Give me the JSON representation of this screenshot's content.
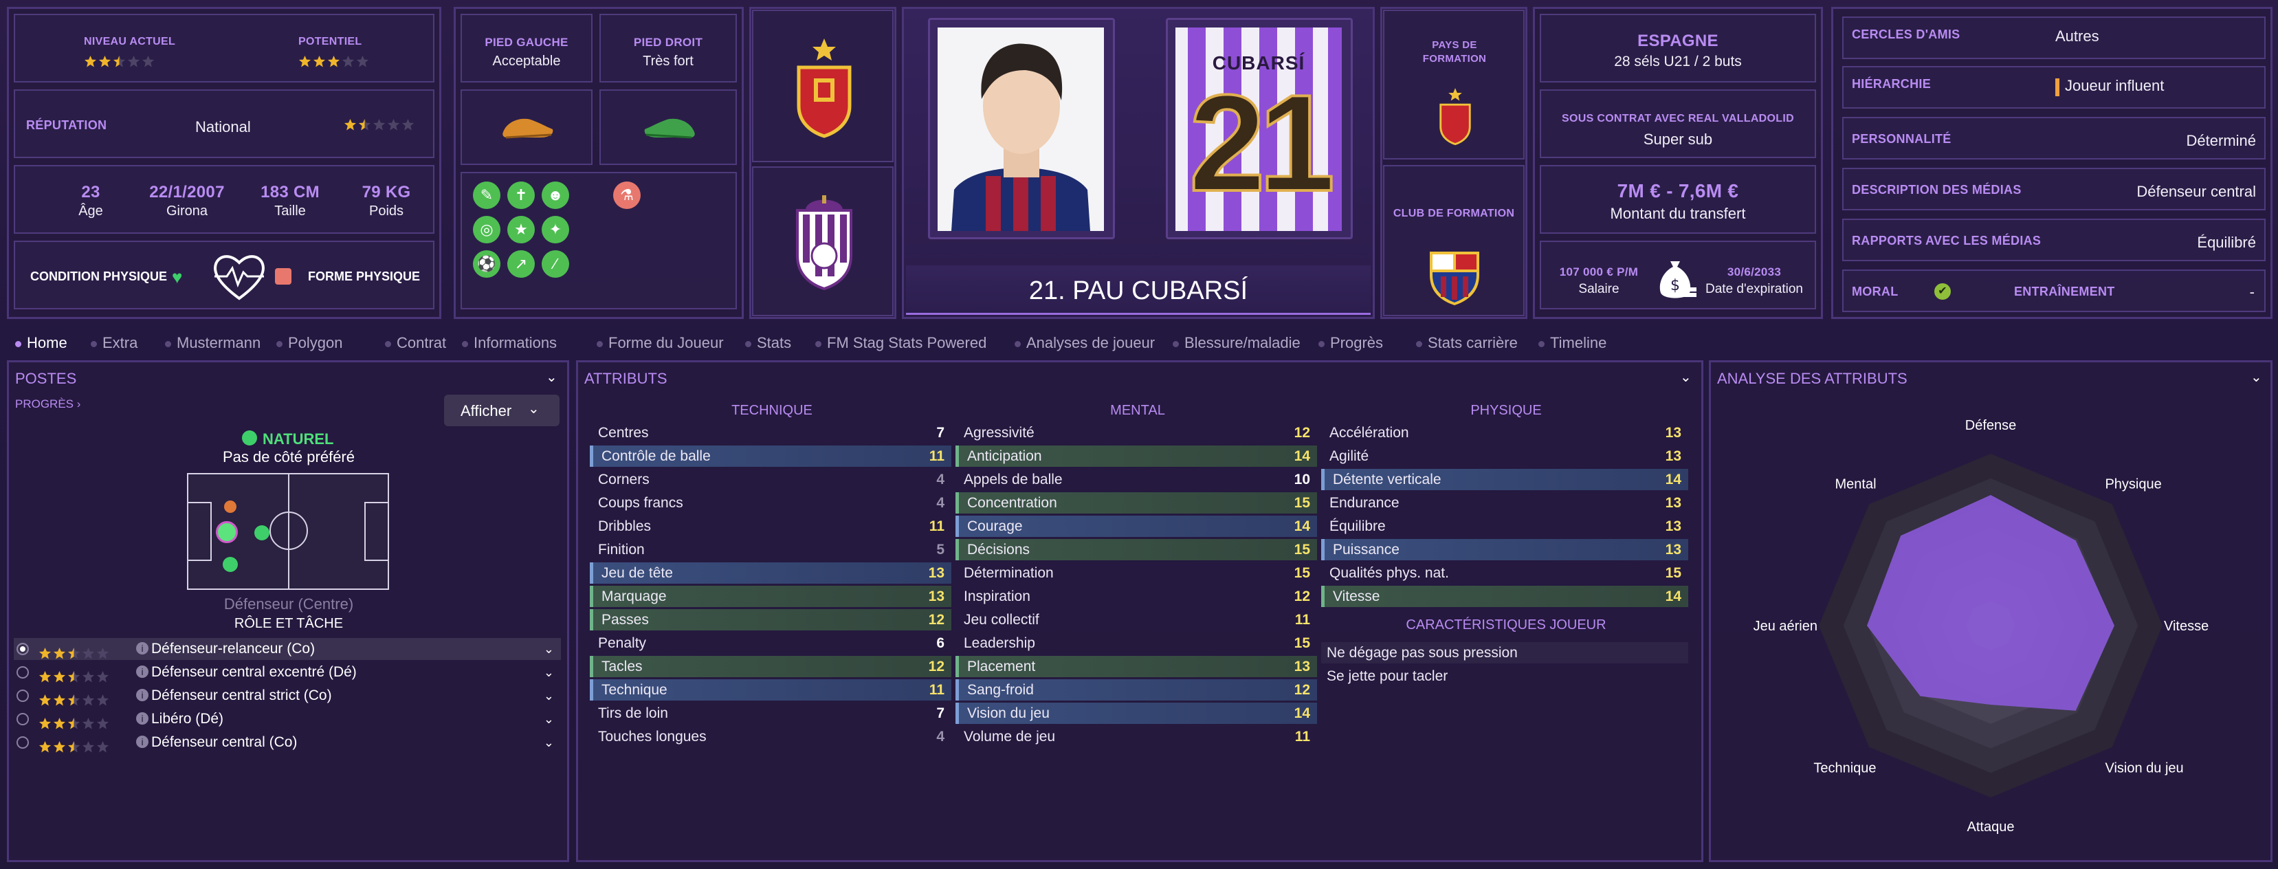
{
  "header": {
    "niveau_actuel_label": "NIVEAU ACTUEL",
    "potentiel_label": "POTENTIEL",
    "niveau_actuel_stars": 2.5,
    "potentiel_stars": 3,
    "reputation_label": "RÉPUTATION",
    "reputation_value": "National",
    "reputation_stars": 1.5,
    "age_value": "23",
    "age_label": "Âge",
    "dob_value": "22/1/2007",
    "dob_label": "Girona",
    "height_value": "183 CM",
    "height_label": "Taille",
    "weight_value": "79 KG",
    "weight_label": "Poids",
    "condition_label": "CONDITION PHYSIQUE",
    "forme_label": "FORME PHYSIQUE",
    "pied_gauche_label": "PIED GAUCHE",
    "pied_gauche_value": "Acceptable",
    "pied_droit_label": "PIED DROIT",
    "pied_droit_value": "Très fort",
    "player_name": "21. PAU CUBARSÍ",
    "shirt_name": "CUBARSÍ",
    "shirt_number": "21",
    "pays_formation_label": "PAYS DE FORMATION",
    "club_formation_label": "CLUB DE FORMATION",
    "nation": "ESPAGNE",
    "nation_caps": "28 séls U21 / 2 buts",
    "contract_label": "SOUS CONTRAT AVEC REAL VALLADOLID",
    "contract_value": "Super sub",
    "transfer_value": "7M € - 7,6M €",
    "transfer_label": "Montant du transfert",
    "salary_value": "107 000 € P/M",
    "salary_label": "Salaire",
    "expiry_value": "30/6/2033",
    "expiry_label": "Date d'expiration",
    "cercles_label": "CERCLES D'AMIS",
    "cercles_value": "Autres",
    "hierarchie_label": "HIÉRARCHIE",
    "hierarchie_value": "Joueur influent",
    "personnalite_label": "PERSONNALITÉ",
    "personnalite_value": "Déterminé",
    "medias_desc_label": "DESCRIPTION DES MÉDIAS",
    "medias_desc_value": "Défenseur central",
    "rapports_label": "RAPPORTS AVEC LES MÉDIAS",
    "rapports_value": "Équilibré",
    "moral_label": "MORAL",
    "entrainement_label": "ENTRAÎNEMENT",
    "entrainement_value": "-"
  },
  "tabs": [
    "Home",
    "Extra",
    "Mustermann",
    "Polygon",
    "Contrat",
    "Informations",
    "Forme du Joueur",
    "Stats",
    "FM Stag Stats Powered",
    "Analyses de joueur",
    "Blessure/maladie",
    "Progrès",
    "Stats carrière",
    "Timeline"
  ],
  "postes": {
    "title": "POSTES",
    "progres": "PROGRÈS",
    "afficher": "Afficher",
    "naturel": "NATUREL",
    "cote": "Pas de côté préféré",
    "position_name": "Défenseur (Centre)",
    "role_title": "RÔLE ET TÂCHE",
    "roles": [
      {
        "name": "Défenseur-relanceur (Co)",
        "stars": 2.5
      },
      {
        "name": "Défenseur central excentré (Dé)",
        "stars": 2.5
      },
      {
        "name": "Défenseur central strict (Co)",
        "stars": 2.5
      },
      {
        "name": "Libéro (Dé)",
        "stars": 2.5
      },
      {
        "name": "Défenseur central (Co)",
        "stars": 2.5
      }
    ]
  },
  "attributs": {
    "title": "ATTRIBUTS",
    "technique_title": "TECHNIQUE",
    "mental_title": "MENTAL",
    "physique_title": "PHYSIQUE",
    "technique": [
      {
        "name": "Centres",
        "value": "7"
      },
      {
        "name": "Contrôle de balle",
        "value": "11",
        "hl": "blue"
      },
      {
        "name": "Corners",
        "value": "4"
      },
      {
        "name": "Coups francs",
        "value": "4"
      },
      {
        "name": "Dribbles",
        "value": "11"
      },
      {
        "name": "Finition",
        "value": "5"
      },
      {
        "name": "Jeu de tête",
        "value": "13",
        "hl": "blue"
      },
      {
        "name": "Marquage",
        "value": "13",
        "hl": "green"
      },
      {
        "name": "Passes",
        "value": "12",
        "hl": "green"
      },
      {
        "name": "Penalty",
        "value": "6"
      },
      {
        "name": "Tacles",
        "value": "12",
        "hl": "green"
      },
      {
        "name": "Technique",
        "value": "11",
        "hl": "blue"
      },
      {
        "name": "Tirs de loin",
        "value": "7"
      },
      {
        "name": "Touches longues",
        "value": "4"
      }
    ],
    "mental": [
      {
        "name": "Agressivité",
        "value": "12"
      },
      {
        "name": "Anticipation",
        "value": "14",
        "hl": "green"
      },
      {
        "name": "Appels de balle",
        "value": "10"
      },
      {
        "name": "Concentration",
        "value": "15",
        "hl": "green"
      },
      {
        "name": "Courage",
        "value": "14",
        "hl": "blue"
      },
      {
        "name": "Décisions",
        "value": "15",
        "hl": "green"
      },
      {
        "name": "Détermination",
        "value": "15"
      },
      {
        "name": "Inspiration",
        "value": "12"
      },
      {
        "name": "Jeu collectif",
        "value": "11"
      },
      {
        "name": "Leadership",
        "value": "15"
      },
      {
        "name": "Placement",
        "value": "13",
        "hl": "green"
      },
      {
        "name": "Sang-froid",
        "value": "12",
        "hl": "blue"
      },
      {
        "name": "Vision du jeu",
        "value": "14",
        "hl": "blue"
      },
      {
        "name": "Volume de jeu",
        "value": "11"
      }
    ],
    "physique": [
      {
        "name": "Accélération",
        "value": "13"
      },
      {
        "name": "Agilité",
        "value": "13"
      },
      {
        "name": "Détente verticale",
        "value": "14",
        "hl": "blue"
      },
      {
        "name": "Endurance",
        "value": "13"
      },
      {
        "name": "Équilibre",
        "value": "13"
      },
      {
        "name": "Puissance",
        "value": "13",
        "hl": "blue"
      },
      {
        "name": "Qualités phys. nat.",
        "value": "15"
      },
      {
        "name": "Vitesse",
        "value": "14",
        "hl": "green"
      }
    ],
    "carac_title": "CARACTÉRISTIQUES JOUEUR",
    "carac": [
      "Ne dégage pas sous pression",
      "Se jette pour tacler"
    ]
  },
  "analyse": {
    "title": "ANALYSE DES ATTRIBUTS",
    "axes": [
      "Défense",
      "Physique",
      "Vitesse",
      "Vision du jeu",
      "Attaque",
      "Technique",
      "Jeu aérien",
      "Mental"
    ],
    "levels": [
      0.76,
      0.7,
      0.72,
      0.7,
      0.46,
      0.58,
      0.72,
      0.74
    ]
  },
  "colors": {
    "accent": "#b98cf2",
    "star_gold": "#f0b52a",
    "value_yellow": "#f7e36a",
    "polygon": "#8a5ad8"
  }
}
